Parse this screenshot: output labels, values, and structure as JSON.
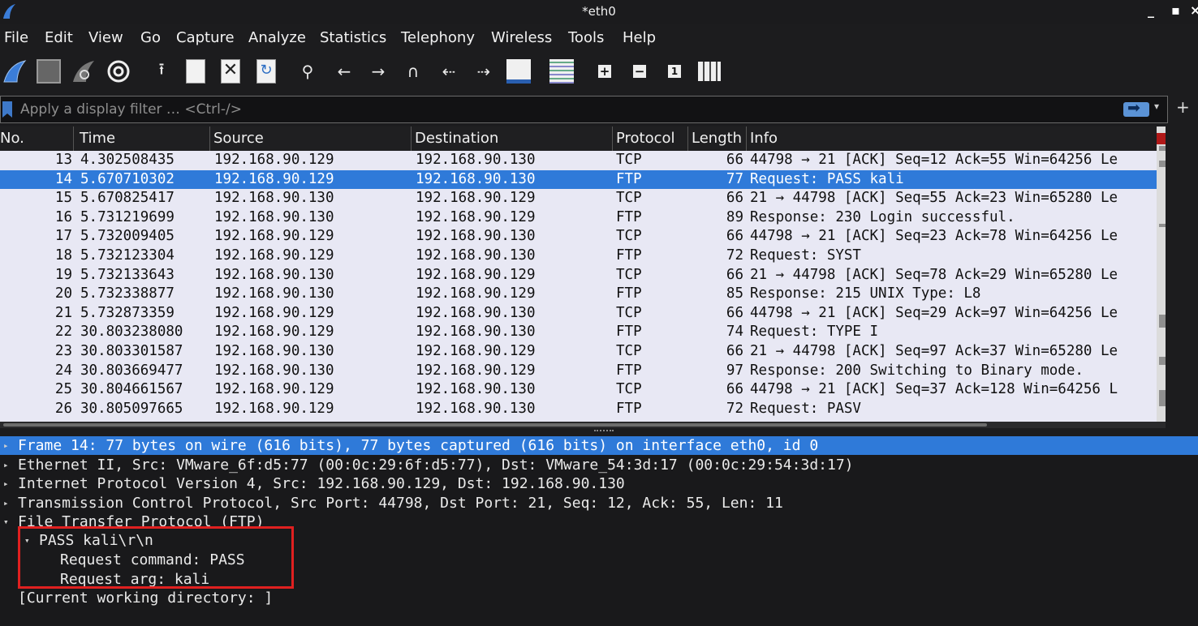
{
  "window": {
    "title": "*eth0",
    "minimize": "_",
    "maximize": "▪",
    "close": "×"
  },
  "menu": [
    "File",
    "Edit",
    "View",
    "Go",
    "Capture",
    "Analyze",
    "Statistics",
    "Telephony",
    "Wireless",
    "Tools",
    "Help"
  ],
  "toolbar": {
    "icons": [
      "start-capture-icon",
      "stop-capture-icon",
      "restart-capture-icon",
      "capture-options-icon",
      "open-file-icon",
      "save-file-icon",
      "close-file-icon",
      "reload-file-icon",
      "find-packet-icon",
      "go-back-icon",
      "go-forward-icon",
      "go-to-packet-icon",
      "first-packet-icon",
      "last-packet-icon",
      "autoscroll-icon",
      "colorize-icon",
      "zoom-in-icon",
      "zoom-out-icon",
      "normal-size-icon",
      "resize-columns-icon"
    ]
  },
  "filter": {
    "placeholder": "Apply a display filter … <Ctrl-/>",
    "value": ""
  },
  "packet_list": {
    "columns": [
      "No.",
      "Time",
      "Source",
      "Destination",
      "Protocol",
      "Length",
      "Info"
    ],
    "rows": [
      {
        "no": "13",
        "time": "4.302508435",
        "src": "192.168.90.129",
        "dst": "192.168.90.130",
        "proto": "TCP",
        "len": "66",
        "info": "44798 → 21 [ACK] Seq=12 Ack=55 Win=64256 Le"
      },
      {
        "no": "14",
        "time": "5.670710302",
        "src": "192.168.90.129",
        "dst": "192.168.90.130",
        "proto": "FTP",
        "len": "77",
        "info": "Request: PASS kali",
        "selected": true
      },
      {
        "no": "15",
        "time": "5.670825417",
        "src": "192.168.90.130",
        "dst": "192.168.90.129",
        "proto": "TCP",
        "len": "66",
        "info": "21 → 44798 [ACK] Seq=55 Ack=23 Win=65280 Le"
      },
      {
        "no": "16",
        "time": "5.731219699",
        "src": "192.168.90.130",
        "dst": "192.168.90.129",
        "proto": "FTP",
        "len": "89",
        "info": "Response: 230 Login successful."
      },
      {
        "no": "17",
        "time": "5.732009405",
        "src": "192.168.90.129",
        "dst": "192.168.90.130",
        "proto": "TCP",
        "len": "66",
        "info": "44798 → 21 [ACK] Seq=23 Ack=78 Win=64256 Le"
      },
      {
        "no": "18",
        "time": "5.732123304",
        "src": "192.168.90.129",
        "dst": "192.168.90.130",
        "proto": "FTP",
        "len": "72",
        "info": "Request: SYST"
      },
      {
        "no": "19",
        "time": "5.732133643",
        "src": "192.168.90.130",
        "dst": "192.168.90.129",
        "proto": "TCP",
        "len": "66",
        "info": "21 → 44798 [ACK] Seq=78 Ack=29 Win=65280 Le"
      },
      {
        "no": "20",
        "time": "5.732338877",
        "src": "192.168.90.130",
        "dst": "192.168.90.129",
        "proto": "FTP",
        "len": "85",
        "info": "Response: 215 UNIX Type: L8"
      },
      {
        "no": "21",
        "time": "5.732873359",
        "src": "192.168.90.129",
        "dst": "192.168.90.130",
        "proto": "TCP",
        "len": "66",
        "info": "44798 → 21 [ACK] Seq=29 Ack=97 Win=64256 Le"
      },
      {
        "no": "22",
        "time": "30.803238080",
        "src": "192.168.90.129",
        "dst": "192.168.90.130",
        "proto": "FTP",
        "len": "74",
        "info": "Request: TYPE I"
      },
      {
        "no": "23",
        "time": "30.803301587",
        "src": "192.168.90.130",
        "dst": "192.168.90.129",
        "proto": "TCP",
        "len": "66",
        "info": "21 → 44798 [ACK] Seq=97 Ack=37 Win=65280 Le"
      },
      {
        "no": "24",
        "time": "30.803669477",
        "src": "192.168.90.130",
        "dst": "192.168.90.129",
        "proto": "FTP",
        "len": "97",
        "info": "Response: 200 Switching to Binary mode."
      },
      {
        "no": "25",
        "time": "30.804661567",
        "src": "192.168.90.129",
        "dst": "192.168.90.130",
        "proto": "TCP",
        "len": "66",
        "info": "44798 → 21 [ACK] Seq=37 Ack=128 Win=64256 L"
      },
      {
        "no": "26",
        "time": "30.805097665",
        "src": "192.168.90.129",
        "dst": "192.168.90.130",
        "proto": "FTP",
        "len": "72",
        "info": "Request: PASV"
      }
    ]
  },
  "details": [
    {
      "text": "Frame 14: 77 bytes on wire (616 bits), 77 bytes captured (616 bits) on interface eth0, id 0",
      "expander": "▸",
      "indent": 0,
      "selected": true
    },
    {
      "text": "Ethernet II, Src: VMware_6f:d5:77 (00:0c:29:6f:d5:77), Dst: VMware_54:3d:17 (00:0c:29:54:3d:17)",
      "expander": "▸",
      "indent": 0
    },
    {
      "text": "Internet Protocol Version 4, Src: 192.168.90.129, Dst: 192.168.90.130",
      "expander": "▸",
      "indent": 0
    },
    {
      "text": "Transmission Control Protocol, Src Port: 44798, Dst Port: 21, Seq: 12, Ack: 55, Len: 11",
      "expander": "▸",
      "indent": 0
    },
    {
      "text": "File Transfer Protocol (FTP)",
      "expander": "▾",
      "indent": 0
    },
    {
      "text": "PASS kali\\r\\n",
      "expander": "▾",
      "indent": 1
    },
    {
      "text": "Request command: PASS",
      "expander": "",
      "indent": 2
    },
    {
      "text": "Request arg: kali",
      "expander": "",
      "indent": 2
    },
    {
      "text": "[Current working directory: ]",
      "expander": "",
      "indent": 0
    }
  ],
  "colors": {
    "selected": "#2f7ad9",
    "highlight_box": "#e02020",
    "list_bg": "#e8e8f4"
  }
}
